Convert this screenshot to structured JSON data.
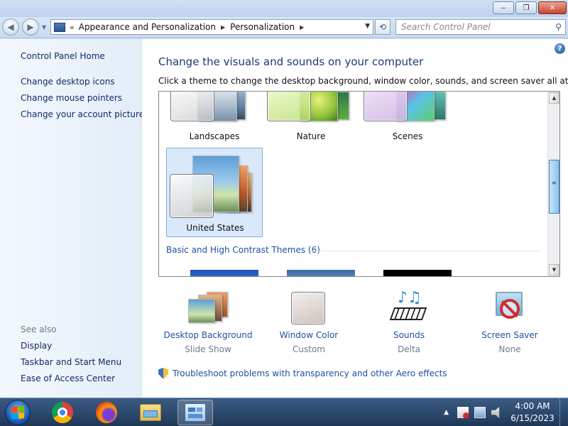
{
  "titlebar": {
    "minimize": "‒",
    "maximize": "❐",
    "close": "✕"
  },
  "address": {
    "back": "◀",
    "forward": "▶",
    "chevrons": "«",
    "crumbs": [
      "Appearance and Personalization",
      "Personalization"
    ],
    "refresh": "⟲",
    "search_placeholder": "Search Control Panel"
  },
  "sidebar": {
    "home": "Control Panel Home",
    "links": [
      "Change desktop icons",
      "Change mouse pointers",
      "Change your account picture"
    ],
    "see_also_label": "See also",
    "see_also": [
      "Display",
      "Taskbar and Start Menu",
      "Ease of Access Center"
    ]
  },
  "main": {
    "help": "?",
    "heading": "Change the visuals and sounds on your computer",
    "subheading": "Click a theme to change the desktop background, window color, sounds, and screen saver all at once.",
    "themes": [
      {
        "name": "Landscapes",
        "color": "#d5d5d5",
        "selected": false
      },
      {
        "name": "Nature",
        "color": "#b9dd6b",
        "selected": false
      },
      {
        "name": "Scenes",
        "color": "#cdb3e0",
        "selected": false
      },
      {
        "name": "United States",
        "color": "#dcd6d2",
        "selected": true
      }
    ],
    "group_header": "Basic and High Contrast Themes (6)",
    "scroll_up": "▲",
    "scroll_down": "▼",
    "grip": "≡",
    "bottom_items": [
      {
        "label": "Desktop Background",
        "sub": "Slide Show"
      },
      {
        "label": "Window Color",
        "sub": "Custom"
      },
      {
        "label": "Sounds",
        "sub": "Delta"
      },
      {
        "label": "Screen Saver",
        "sub": "None"
      }
    ],
    "troubleshoot": "Troubleshoot problems with transparency and other Aero effects"
  },
  "taskbar": {
    "time": "4:00 AM",
    "date": "6/15/2023",
    "tray_arrow": "▲"
  }
}
